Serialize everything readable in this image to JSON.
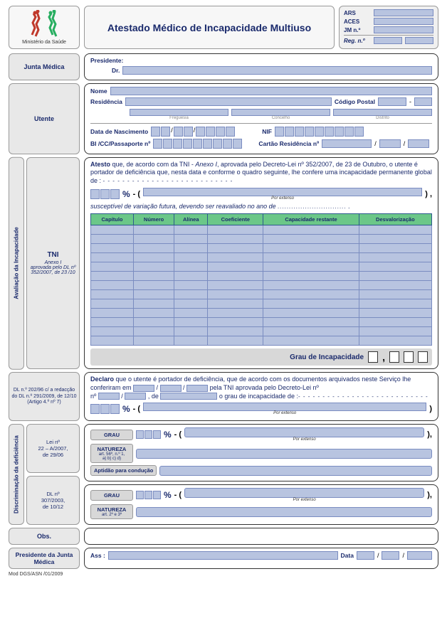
{
  "header": {
    "logo_caption": "Ministério da Saúde",
    "title": "Atestado Médico de Incapacidade Multiuso",
    "ref": {
      "ars": "ARS",
      "aces": "ACES",
      "jm": "JM  n.º",
      "reg": "Reg. n.º"
    }
  },
  "junta_medica": {
    "label": "Junta Médica",
    "presidente": "Presidente:",
    "dr": "Dr."
  },
  "utente": {
    "label": "Utente",
    "nome": "Nome",
    "residencia": "Residência",
    "codigo_postal": "Código Postal",
    "freguesia": "Freguesia",
    "concelho": "Concelho",
    "distrito": "Distrito",
    "data_nasc": "Data de Nascimento",
    "nif": "NIF",
    "bi": "BI /CC/Passaporte nº",
    "cartao": "Cartão Residência nº"
  },
  "avaliacao": {
    "vert_label": "Avaliação da Incapacidade",
    "tni_label": "TNI",
    "tni_sub": "Anexo I\naprovada pelo DL nº 352/2007, de 23 /10",
    "atesto_bold": "Atesto",
    "atesto_text": " que, de acordo com da TNI - ",
    "anexo_i": "Anexo I",
    "atesto_text2": ", aprovada pelo Decreto-Lei nº 352/2007, de 23 de Outubro, o utente é portador de deficiência que, nesta data e conforme o quadro seguinte, lhe confere uma incapacidade permanente global de :",
    "dots": "- - - - - - - - - - - - - - - - - - - - - - - - - - -",
    "pct": "%",
    "dash_paren": "- (",
    "por_extenso": "Por extenso",
    "close_paren": ") ,",
    "suscept": "susceptível de variação futura, devendo ser reavaliado no ano de",
    "dots2": "..............................",
    "table_headers": [
      "Capítulo",
      "Número",
      "Alínea",
      "Coeficiente",
      "Capacidade restante",
      "Desvalorização"
    ],
    "table_rows": 13,
    "grau_label": "Grau de Incapacidade"
  },
  "declaro": {
    "side1": "DL n.º  202/96 c/ a redacção do DL n.º 291/2009, de 12/10\n(Artigo 4.º nº 7)",
    "bold": "Declaro",
    "text1": " que o utente é portador de deficiência, que de acordo com os documentos arquivados neste Serviço lhe conferiram em ",
    "text2": " pela TNI aprovada pelo Decreto-Lei nº",
    "text3": ", de ",
    "text4": " o grau de incapacidade de :",
    "por_extenso": "Por extenso"
  },
  "discrim": {
    "vert_label": "Discriminação da deficiência",
    "lei1": "Lei  nº\n22 – A/2007,\nde 29/06",
    "dl2": "DL  nº\n307/2003,\nde 10/12",
    "grau": "GRAU",
    "natureza": "NATUREZA",
    "nat1_sub": "art. 56º, n.º 1,\na) b) c) d)",
    "aptidao": "Aptidão para condução",
    "nat2_sub": "art. 2º e 3º",
    "por_extenso": "Por extenso"
  },
  "obs": {
    "label": "Obs."
  },
  "sign": {
    "label": "Presidente da Junta Médica",
    "ass": "Ass :",
    "data": "Data"
  },
  "footer": "Mod DGS/ASN /01/2009"
}
